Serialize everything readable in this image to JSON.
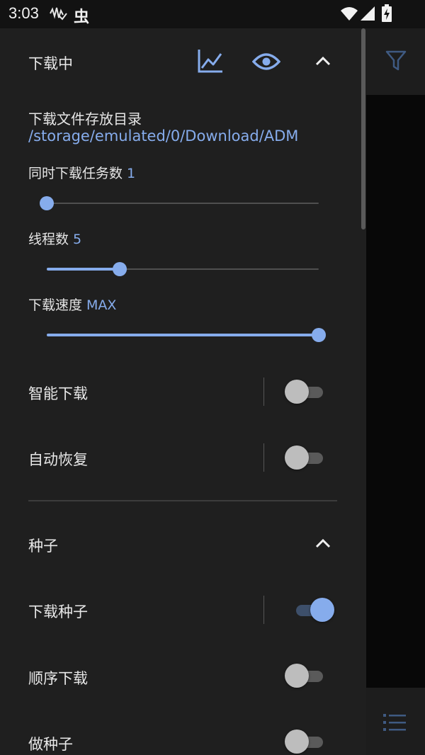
{
  "status_bar": {
    "time": "3:03",
    "notif_char": "虫"
  },
  "panel": {
    "header": {
      "title": "下载中",
      "icons": [
        "chart-icon",
        "eye-icon",
        "chevron-up-icon"
      ]
    },
    "download_dir": {
      "label": "下载文件存放目录",
      "path": "/storage/emulated/0/Download/ADM"
    },
    "concurrent_tasks": {
      "label": "同时下载任务数",
      "value": "1",
      "level": 0.0
    },
    "threads": {
      "label": "线程数",
      "value": "5",
      "level": 0.267
    },
    "speed": {
      "label": "下载速度",
      "value": "MAX",
      "level": 1.0
    },
    "smart_download": {
      "label": "智能下载",
      "on": false
    },
    "auto_resume": {
      "label": "自动恢复",
      "on": false
    },
    "torrent_section": {
      "title": "种子",
      "icon": "chevron-up-icon"
    },
    "download_torrent": {
      "label": "下载种子",
      "on": true
    },
    "sequential": {
      "label": "顺序下载",
      "on": false
    },
    "seeding": {
      "label": "做种子",
      "on": false
    }
  },
  "colors": {
    "accent": "#86acec",
    "panel_bg": "#1f1f1f"
  }
}
